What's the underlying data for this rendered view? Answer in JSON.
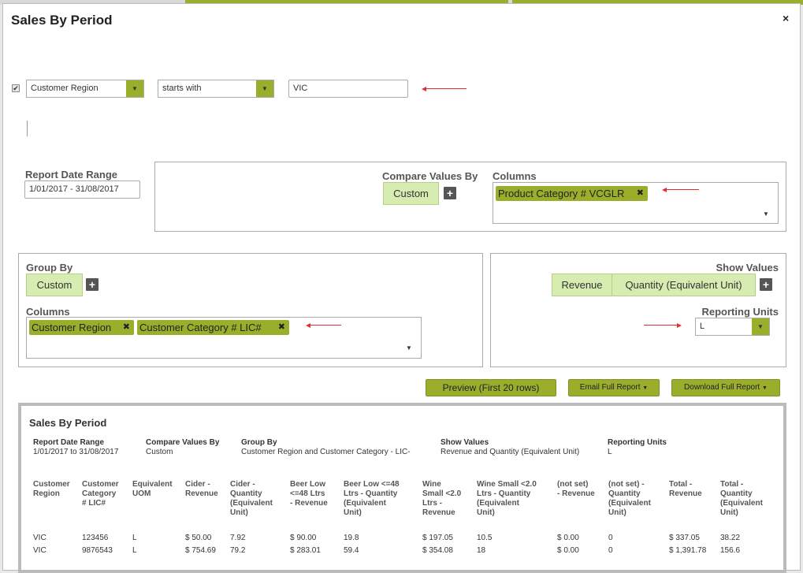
{
  "dialog": {
    "title": "Sales By Period",
    "close_glyph": "×"
  },
  "filter": {
    "checkbox_glyph": "✔",
    "field": "Customer Region",
    "operator": "starts with",
    "value": "VIC"
  },
  "report_date_range": {
    "label": "Report Date Range",
    "value": "1/01/2017 - 31/08/2017"
  },
  "compare": {
    "label": "Compare Values By",
    "button": "Custom",
    "columns_label": "Columns",
    "tags": [
      "Product Category # VCGLR"
    ]
  },
  "group_by": {
    "label": "Group By",
    "button": "Custom",
    "columns_label": "Columns",
    "tags": [
      "Customer Region",
      "Customer Category # LIC#"
    ]
  },
  "show_values": {
    "label": "Show Values",
    "buttons": [
      "Revenue",
      "Quantity (Equivalent Unit)"
    ],
    "reporting_units_label": "Reporting Units",
    "reporting_units_value": "L"
  },
  "icons": {
    "plus": "+",
    "remove": "✖",
    "dropdown": "▼"
  },
  "actions": {
    "preview": "Preview (First 20 rows)",
    "email": "Email Full Report",
    "download": "Download Full Report"
  },
  "preview": {
    "title": "Sales By Period",
    "meta": [
      {
        "label": "Report Date Range",
        "value": "1/01/2017 to 31/08/2017"
      },
      {
        "label": "Compare Values By",
        "value": "Custom"
      },
      {
        "label": "Group By",
        "value": "Customer Region and Customer Category - LIC-"
      },
      {
        "label": "Show Values",
        "value": "Revenue and Quantity (Equivalent Unit)"
      },
      {
        "label": "Reporting Units",
        "value": "L"
      }
    ],
    "columns": [
      [
        "Customer",
        "Region"
      ],
      [
        "Customer",
        "Category",
        "# LIC#"
      ],
      [
        "Equivalent",
        "UOM"
      ],
      [
        "Cider -",
        "Revenue"
      ],
      [
        "Cider -",
        "Quantity",
        "(Equivalent",
        "Unit)"
      ],
      [
        "Beer Low",
        "<=48 Ltrs",
        "- Revenue"
      ],
      [
        "Beer Low <=48",
        "Ltrs - Quantity",
        "(Equivalent",
        "Unit)"
      ],
      [
        "Wine",
        "Small <2.0",
        "Ltrs -",
        "Revenue"
      ],
      [
        "Wine Small <2.0",
        "Ltrs - Quantity",
        "(Equivalent",
        "Unit)"
      ],
      [
        "(not set)",
        "- Revenue"
      ],
      [
        "(not set) -",
        "Quantity",
        "(Equivalent",
        "Unit)"
      ],
      [
        "Total -",
        "Revenue"
      ],
      [
        "Total -",
        "Quantity",
        "(Equivalent",
        "Unit)"
      ]
    ],
    "rows": [
      [
        "VIC",
        "123456",
        "L",
        "$ 50.00",
        "7.92",
        "$ 90.00",
        "19.8",
        "$ 197.05",
        "10.5",
        "$ 0.00",
        "0",
        "$ 337.05",
        "38.22"
      ],
      [
        "VIC",
        "9876543",
        "L",
        "$ 754.69",
        "79.2",
        "$ 283.01",
        "59.4",
        "$ 354.08",
        "18",
        "$ 0.00",
        "0",
        "$ 1,391.78",
        "156.6"
      ]
    ]
  },
  "colors": {
    "accent": "#9aae2c",
    "light_accent": "#d7ecb0",
    "annotation": "#e03030"
  }
}
